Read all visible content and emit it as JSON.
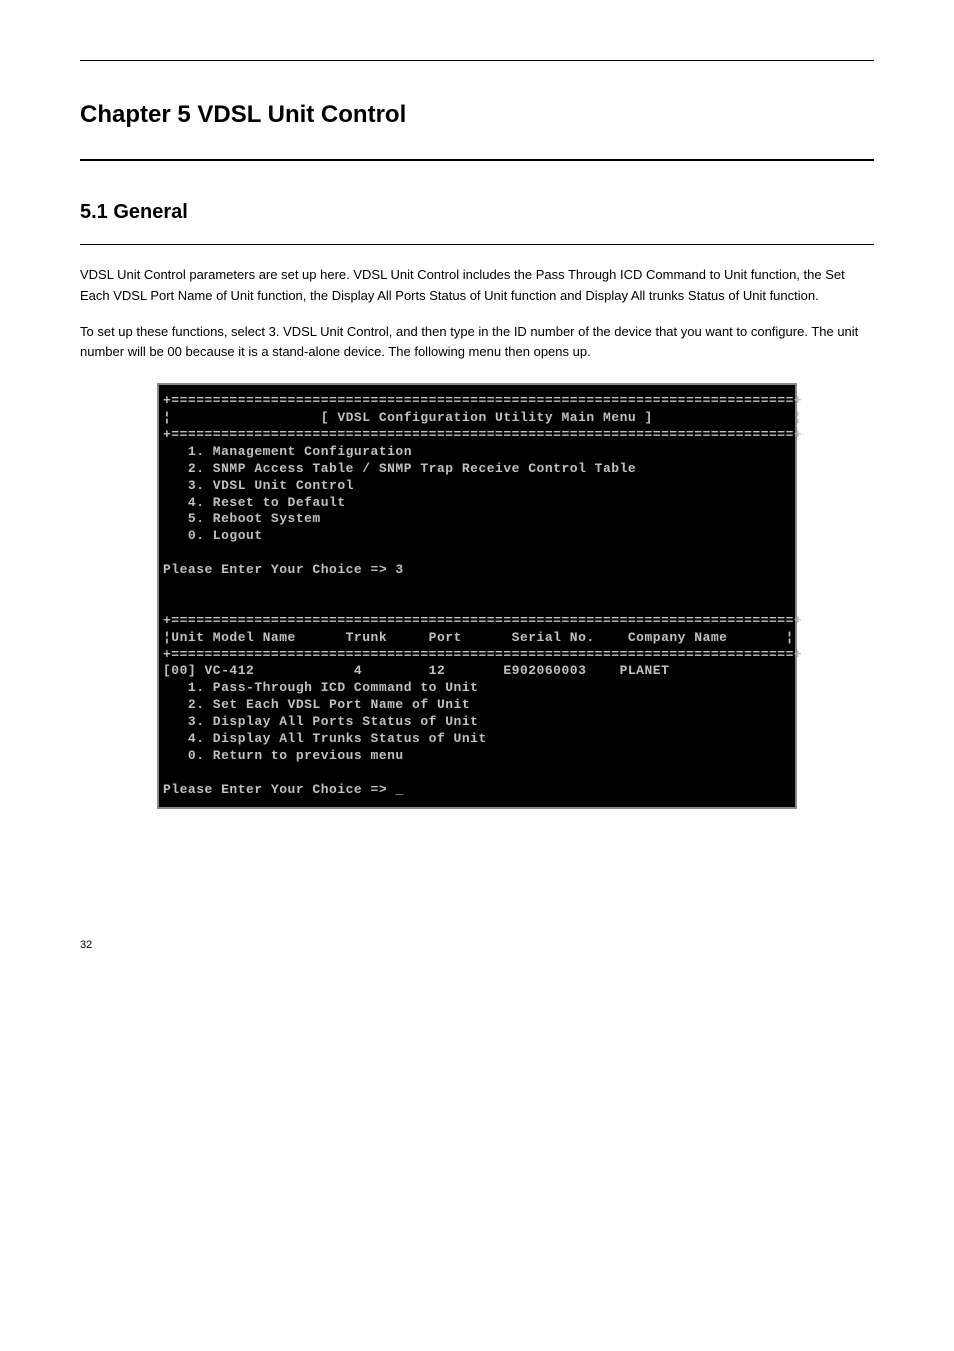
{
  "chapter": {
    "title": "Chapter 5 VDSL Unit Control"
  },
  "section": {
    "heading": "5.1 General",
    "paragraph1": "VDSL Unit Control parameters are set up here. VDSL Unit Control includes the Pass Through ICD Command to Unit function, the Set Each VDSL Port Name of Unit function, the Display All Ports Status of Unit function and Display All trunks Status of Unit function.",
    "paragraph2": "To set up these functions, select 3. VDSL Unit Control, and then type in the ID number of the device that you want to configure. The unit number will be 00 because it is a stand-alone device. The following menu then opens up."
  },
  "terminal": {
    "border_line": "+===========================================================================+",
    "title_line": "¦                  [ VDSL Configuration Utility Main Menu ]                 ¦",
    "menu1": "   1. Management Configuration",
    "menu2": "   2. SNMP Access Table / SNMP Trap Receive Control Table",
    "menu3": "   3. VDSL Unit Control",
    "menu4": "   4. Reset to Default",
    "menu5": "   5. Reboot System",
    "menu0": "   0. Logout",
    "prompt1": "Please Enter Your Choice => 3",
    "header_line": "¦Unit Model Name      Trunk     Port      Serial No.    Company Name       ¦",
    "data_line": "[00] VC-412            4        12       E902060003    PLANET",
    "submenu1": "   1. Pass-Through ICD Command to Unit",
    "submenu2": "   2. Set Each VDSL Port Name of Unit",
    "submenu3": "   3. Display All Ports Status of Unit",
    "submenu4": "   4. Display All Trunks Status of Unit",
    "submenu0": "   0. Return to previous menu",
    "prompt2": "Please Enter Your Choice => _"
  },
  "page_footer": "32"
}
